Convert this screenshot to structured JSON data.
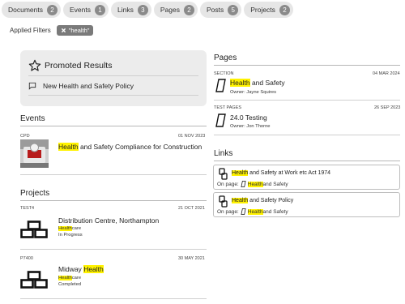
{
  "tabs": [
    {
      "label": "Documents",
      "count": "2"
    },
    {
      "label": "Events",
      "count": "1"
    },
    {
      "label": "Links",
      "count": "3"
    },
    {
      "label": "Pages",
      "count": "2"
    },
    {
      "label": "Posts",
      "count": "5"
    },
    {
      "label": "Projects",
      "count": "2"
    }
  ],
  "filters": {
    "label": "Applied Filters",
    "chip": "\"health\"",
    "chip_icon": "close-icon"
  },
  "promoted": {
    "title": "Promoted Results",
    "icon": "star-icon",
    "item": "New Health and Safety Policy",
    "item_icon": "chat-icon"
  },
  "events": {
    "heading": "Events",
    "items": [
      {
        "type": "CPD",
        "date": "01 NOV 2023",
        "title_highlight": "Health",
        "title_rest": " and Safety Compliance for Construction",
        "thumb": "event-thumbnail"
      }
    ]
  },
  "projects": {
    "heading": "Projects",
    "items": [
      {
        "code": "TEST4",
        "date": "21 OCT 2021",
        "title": "Distribution Centre, Northampton",
        "sector_highlight": "Health",
        "sector_rest": "care",
        "status": "In Progress",
        "icon": "bricks-icon"
      },
      {
        "code": "P7400",
        "date": "30 MAY 2021",
        "title_plain": "Midway ",
        "title_highlight": "Health",
        "sector_highlight": "Health",
        "sector_rest": "care",
        "status": "Completed",
        "icon": "bricks-icon"
      }
    ]
  },
  "pages": {
    "heading": "Pages",
    "items": [
      {
        "type": "SECTION",
        "date": "04 MAR 2024",
        "title_highlight": "Health",
        "title_rest": " and Safety",
        "owner": "Owner: Jayne Squires",
        "icon": "page-icon"
      },
      {
        "type": "TEST PAGES",
        "date": "26 SEP 2023",
        "title": "24.0 Testing",
        "owner": "Owner: Jon Thorne",
        "icon": "page-icon"
      }
    ]
  },
  "links": {
    "heading": "Links",
    "items": [
      {
        "title_highlight": "Health",
        "title_rest": " and Safety at Work etc Act 1974",
        "on_page": "On page:",
        "page_highlight": "Health",
        "page_rest": "and Safety",
        "icon": "link-icon"
      },
      {
        "title_highlight": "Health",
        "title_rest": " and Safety Policy",
        "on_page": "On page:",
        "page_highlight": "Health",
        "page_rest": "and Safety",
        "icon": "link-icon"
      }
    ]
  }
}
